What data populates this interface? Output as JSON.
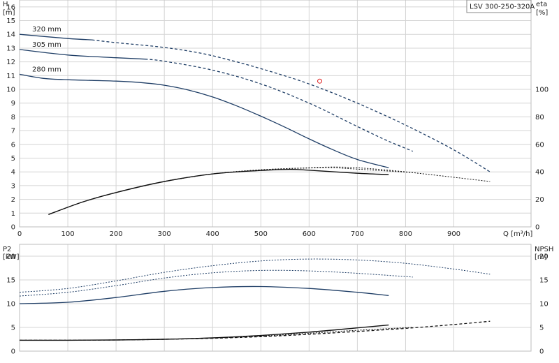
{
  "model": "LSV 300-250-320A",
  "colors": {
    "curve": "#1f3e66",
    "npsh": "#111111",
    "marker": "#e02020",
    "grid": "#d4d4d4"
  },
  "axes": {
    "h_label": "H",
    "h_unit": "[m]",
    "eta_label": "eta",
    "eta_unit": "[%]",
    "q_label": "Q [m³/h]",
    "p2_label": "P2",
    "p2_unit": "[kW]",
    "npsh_label": "NPSH",
    "npsh_unit": "[m]"
  },
  "chart_data": [
    {
      "type": "line",
      "x_ticks": [
        0,
        100,
        200,
        300,
        400,
        500,
        600,
        700,
        800,
        900
      ],
      "xlim": [
        0,
        1060
      ],
      "y_ticks": [
        0,
        1,
        2,
        3,
        4,
        5,
        6,
        7,
        8,
        9,
        10,
        11,
        12,
        13,
        14,
        15,
        16
      ],
      "ylim": [
        0,
        16.5
      ],
      "eta_ticks": [
        0,
        20,
        40,
        60,
        80,
        100
      ],
      "eta_ylim": [
        0,
        165
      ],
      "series": [
        {
          "name": "320 mm",
          "style": "solid",
          "x": [
            0,
            100,
            150
          ],
          "y": [
            14.0,
            13.7,
            13.6
          ]
        },
        {
          "name": "",
          "style": "dash",
          "x": [
            150,
            200,
            300,
            380,
            450,
            520,
            600,
            700,
            800,
            900,
            975
          ],
          "y": [
            13.6,
            13.4,
            13.05,
            12.6,
            12.0,
            11.3,
            10.4,
            9.0,
            7.4,
            5.6,
            4.0
          ]
        },
        {
          "name": "305 mm",
          "style": "solid",
          "x": [
            0,
            100,
            200,
            260
          ],
          "y": [
            12.9,
            12.5,
            12.3,
            12.2
          ]
        },
        {
          "name": "",
          "style": "dash",
          "x": [
            260,
            300,
            400,
            500,
            600,
            700,
            760,
            815
          ],
          "y": [
            12.2,
            12.05,
            11.4,
            10.4,
            9.0,
            7.3,
            6.3,
            5.5
          ]
        },
        {
          "name": "280 mm",
          "style": "solid",
          "x": [
            0,
            50,
            100,
            150,
            200,
            250,
            300,
            350,
            400,
            450,
            500,
            550,
            600,
            650,
            700,
            765
          ],
          "y": [
            11.1,
            10.8,
            10.7,
            10.65,
            10.6,
            10.5,
            10.3,
            9.95,
            9.45,
            8.8,
            8.05,
            7.25,
            6.4,
            5.6,
            4.9,
            4.3
          ]
        },
        {
          "name": "",
          "style": "eta-solid",
          "x": [
            60,
            130,
            200,
            300,
            400,
            500,
            560,
            600,
            700,
            765
          ],
          "y": [
            0.9,
            1.8,
            2.5,
            3.3,
            3.85,
            4.1,
            4.18,
            4.12,
            3.9,
            3.8
          ]
        },
        {
          "name": "",
          "style": "eta-dot",
          "x": [
            60,
            130,
            200,
            300,
            400,
            500,
            600,
            650,
            700,
            815
          ],
          "y": [
            0.9,
            1.8,
            2.5,
            3.3,
            3.85,
            4.15,
            4.28,
            4.3,
            4.2,
            3.95
          ]
        },
        {
          "name": "",
          "style": "eta-dot",
          "x": [
            60,
            130,
            200,
            300,
            400,
            500,
            600,
            650,
            700,
            800,
            975
          ],
          "y": [
            0.9,
            1.8,
            2.5,
            3.3,
            3.85,
            4.15,
            4.3,
            4.35,
            4.3,
            4.0,
            3.3
          ]
        }
      ],
      "marker": {
        "x": 622,
        "y": 10.6
      }
    },
    {
      "type": "line",
      "x_ticks": [
        0,
        100,
        200,
        300,
        400,
        500,
        600,
        700,
        800,
        900
      ],
      "xlim": [
        0,
        1060
      ],
      "y_ticks": [
        0,
        5,
        10,
        15,
        20
      ],
      "ylim": [
        0,
        22.5
      ],
      "npsh_ticks": [
        0,
        5,
        10,
        15,
        20
      ],
      "npsh_ylim": [
        0,
        22.5
      ],
      "series": [
        {
          "name": "",
          "style": "solid",
          "x": [
            0,
            100,
            200,
            300,
            400,
            500,
            600,
            700,
            765
          ],
          "y": [
            10.0,
            10.3,
            11.3,
            12.6,
            13.4,
            13.6,
            13.2,
            12.4,
            11.7
          ]
        },
        {
          "name": "",
          "style": "dot",
          "x": [
            0,
            100,
            200,
            300,
            400,
            500,
            600,
            700,
            815
          ],
          "y": [
            11.6,
            12.4,
            13.8,
            15.4,
            16.5,
            17.0,
            16.9,
            16.4,
            15.6
          ]
        },
        {
          "name": "",
          "style": "dot",
          "x": [
            0,
            100,
            200,
            300,
            400,
            500,
            600,
            700,
            800,
            900,
            975
          ],
          "y": [
            12.4,
            13.2,
            14.8,
            16.6,
            18.0,
            19.0,
            19.4,
            19.2,
            18.5,
            17.3,
            16.2
          ]
        },
        {
          "name": "",
          "style": "npsh-solid",
          "x": [
            0,
            100,
            200,
            300,
            400,
            500,
            600,
            700,
            765
          ],
          "y": [
            2.3,
            2.3,
            2.35,
            2.5,
            2.8,
            3.3,
            4.0,
            4.9,
            5.5
          ]
        },
        {
          "name": "",
          "style": "npsh-dot",
          "x": [
            0,
            100,
            200,
            300,
            400,
            500,
            600,
            700,
            815
          ],
          "y": [
            2.3,
            2.3,
            2.35,
            2.5,
            2.75,
            3.15,
            3.75,
            4.4,
            5.0
          ]
        },
        {
          "name": "",
          "style": "npsh-dash",
          "x": [
            0,
            100,
            200,
            300,
            400,
            500,
            600,
            700,
            800,
            900,
            975
          ],
          "y": [
            2.3,
            2.3,
            2.35,
            2.5,
            2.7,
            3.05,
            3.55,
            4.15,
            4.8,
            5.6,
            6.3
          ]
        }
      ]
    }
  ]
}
